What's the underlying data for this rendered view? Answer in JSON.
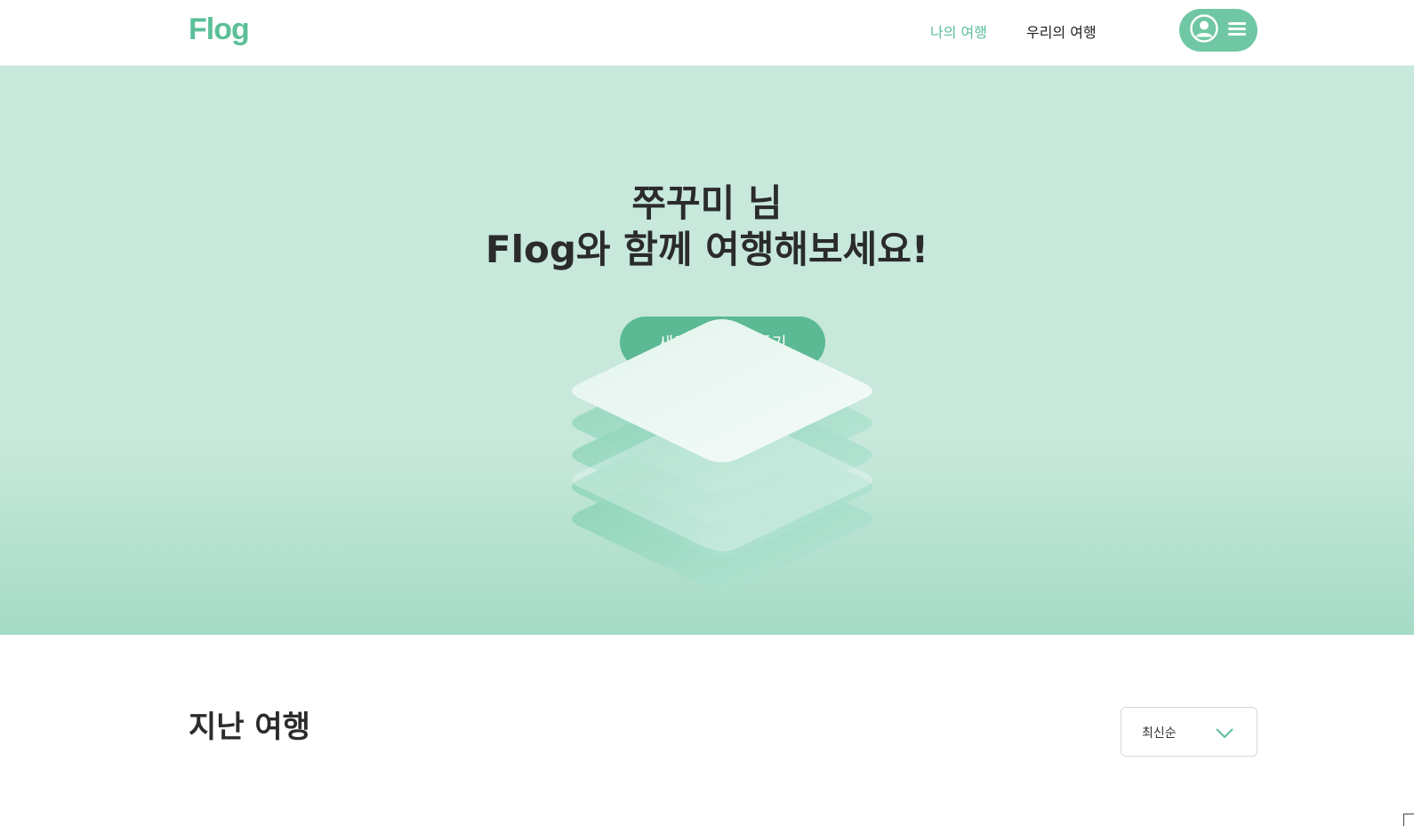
{
  "header": {
    "logo": "Flog",
    "nav": {
      "mine": "나의 여행",
      "ours": "우리의 여행"
    },
    "user_menu": {
      "icons": [
        "user-circle-icon",
        "hamburger-menu-icon"
      ]
    }
  },
  "hero": {
    "greeting": "쭈꾸미 님",
    "tagline": "Flog와 함께 여행해보세요!",
    "cta_label": "새로운 여행 만들기",
    "illustration": "stacked-layers-illustration"
  },
  "past_trips": {
    "title": "지난 여행",
    "sort": {
      "selected": "최신순"
    }
  },
  "colors": {
    "brand": "#5bbf98",
    "hero_bg": "#c7e8db",
    "button": "#5bb993"
  }
}
